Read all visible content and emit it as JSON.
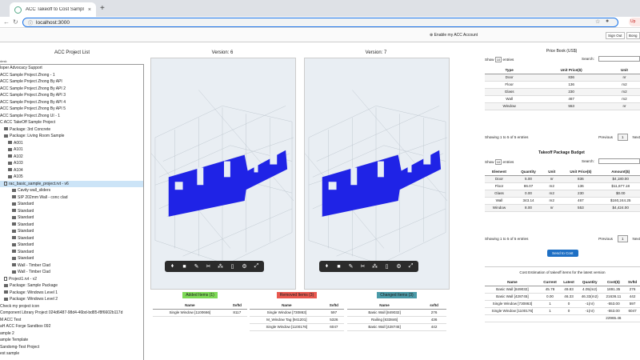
{
  "browser": {
    "tab_title": "ACC Takeoff to Cost Sample",
    "url": "localhost:3000",
    "new_tab_symbol": "+",
    "close_symbol": "×",
    "update_label": "Up"
  },
  "app": {
    "left_stub": "desk",
    "enable_account": "Enable my ACC Account",
    "sign_out": "Sign Out",
    "user_btn": "Bong"
  },
  "project_list": {
    "title": "ACC Project List",
    "items": [
      {
        "label": "loper Advocacy Support",
        "indent": 0,
        "icon": "none"
      },
      {
        "label": "ACC Sample Project Zhong - 1",
        "indent": 0,
        "icon": "none"
      },
      {
        "label": "ACC Sample Project Zhong By API",
        "indent": 0,
        "icon": "none"
      },
      {
        "label": "ACC Sample Project Zhong By API 2",
        "indent": 0,
        "icon": "none"
      },
      {
        "label": "ACC Sample Project Zhong By API 3",
        "indent": 0,
        "icon": "none"
      },
      {
        "label": "ACC Sample Project Zhong By API 4",
        "indent": 0,
        "icon": "none"
      },
      {
        "label": "ACC Sample Project Zhong By API 5",
        "indent": 0,
        "icon": "none"
      },
      {
        "label": "ACC Sample Project Zhong UI - 1",
        "indent": 0,
        "icon": "none"
      },
      {
        "label": "C ACC TakeOff Sample Project",
        "indent": 0,
        "icon": "none"
      },
      {
        "label": "Package: 3rd Concrete",
        "indent": 1,
        "icon": "folder"
      },
      {
        "label": "Package: Living Room Sample",
        "indent": 1,
        "icon": "folder"
      },
      {
        "label": "A001",
        "indent": 2,
        "icon": "folder"
      },
      {
        "label": "A101",
        "indent": 2,
        "icon": "folder"
      },
      {
        "label": "A102",
        "indent": 2,
        "icon": "folder"
      },
      {
        "label": "A103",
        "indent": 2,
        "icon": "folder"
      },
      {
        "label": "A104",
        "indent": 2,
        "icon": "folder"
      },
      {
        "label": "A105",
        "indent": 2,
        "icon": "folder"
      },
      {
        "label": "rac_basic_sample_project.rvt - v6",
        "indent": 1,
        "icon": "doc",
        "selected": true
      },
      {
        "label": "Cavity wall_sliders",
        "indent": 3,
        "icon": "folder"
      },
      {
        "label": "SIP 202mm Wall - conc clad",
        "indent": 3,
        "icon": "folder"
      },
      {
        "label": "Standard",
        "indent": 3,
        "icon": "folder"
      },
      {
        "label": "Standard",
        "indent": 3,
        "icon": "folder"
      },
      {
        "label": "Standard",
        "indent": 3,
        "icon": "folder"
      },
      {
        "label": "Standard",
        "indent": 3,
        "icon": "folder"
      },
      {
        "label": "Standard",
        "indent": 3,
        "icon": "folder"
      },
      {
        "label": "Standard",
        "indent": 3,
        "icon": "folder"
      },
      {
        "label": "Standard",
        "indent": 3,
        "icon": "folder"
      },
      {
        "label": "Standard",
        "indent": 3,
        "icon": "folder"
      },
      {
        "label": "Standard",
        "indent": 3,
        "icon": "folder"
      },
      {
        "label": "Wall - Timber Clad",
        "indent": 3,
        "icon": "folder"
      },
      {
        "label": "Wall - Timber Clad",
        "indent": 3,
        "icon": "folder"
      },
      {
        "label": "Project1.rvt - v2",
        "indent": 1,
        "icon": "doc"
      },
      {
        "label": "Package: Sample Package",
        "indent": 1,
        "icon": "folder"
      },
      {
        "label": "Package: Windows Level 1",
        "indent": 1,
        "icon": "folder"
      },
      {
        "label": "Package: Windows Level 2",
        "indent": 1,
        "icon": "folder"
      },
      {
        "label": "Check my project icon",
        "indent": 0,
        "icon": "none"
      },
      {
        "label": "Component Library Project 024d6487-98d4-46bd-bd85-f8f6602b117d",
        "indent": 0,
        "icon": "none"
      },
      {
        "label": "M ACC Test",
        "indent": 0,
        "icon": "none"
      },
      {
        "label": "aH ACC Forge Sandbox 092",
        "indent": 0,
        "icon": "none"
      },
      {
        "label": "ample 2",
        "indent": 0,
        "icon": "none"
      },
      {
        "label": "ample Template",
        "indent": 0,
        "icon": "none"
      },
      {
        "label": "Sandomg-Test Project",
        "indent": 0,
        "icon": "none"
      },
      {
        "label": "est sample",
        "indent": 0,
        "icon": "none"
      }
    ]
  },
  "viewers": [
    {
      "title": "Version: 6"
    },
    {
      "title": "Version: 7"
    }
  ],
  "toolbar_icons": [
    "walk-icon",
    "camera-icon",
    "measure-icon",
    "section-icon",
    "explode-icon",
    "model-browser-icon",
    "settings-icon",
    "fullscreen-icon"
  ],
  "toolbar_glyphs": [
    "⬧",
    "■",
    "✎",
    "✂",
    "⁂",
    "▯",
    "⚙",
    "⤢"
  ],
  "diff": {
    "added": {
      "label": "Added Items (1)",
      "color": "#7ed957",
      "cols": [
        "Name",
        "SvfId"
      ],
      "rows": [
        [
          "Single Window [1100666]",
          "8117"
        ]
      ]
    },
    "removed": {
      "label": "Removed Items (3)",
      "color": "#e8584f",
      "cols": [
        "Name",
        "SvfId"
      ],
      "rows": [
        [
          "Single Window [730863]",
          "597"
        ],
        [
          "M_Window Tag [941201]",
          "5326"
        ],
        [
          "Single Window [1100176]",
          "6047"
        ]
      ]
    },
    "changed": {
      "label": "Changed Items (3)",
      "color": "#4a9aa8",
      "cols": [
        "Name",
        "svfId"
      ],
      "rows": [
        [
          "Basic Wall [849032]",
          "276"
        ],
        [
          "Railing [833846]",
          "436"
        ],
        [
          "Basic Wall [428745]",
          "442"
        ]
      ]
    }
  },
  "price_book": {
    "title": "Price Book (US$)",
    "show": "Show",
    "entries_val": "10",
    "entries": "entries",
    "search": "Search:",
    "cols": [
      "Type",
      "Unit Price($)",
      "Unit"
    ],
    "rows": [
      [
        "Door",
        "836",
        "nr"
      ],
      [
        "Floor",
        "136",
        "m2"
      ],
      [
        "Glass",
        "230",
        "m2"
      ],
      [
        "Wall",
        "467",
        "m2"
      ],
      [
        "Window",
        "553",
        "nr"
      ]
    ],
    "info": "Showing 1 to 5 of 5 entries",
    "prev": "Previous",
    "page": "1",
    "next": "Next"
  },
  "budget": {
    "title": "Takeoff Package Budget",
    "show": "Show",
    "entries_val": "10",
    "entries": "entries",
    "search": "Search:",
    "cols": [
      "Element",
      "Quantity",
      "Unit",
      "Unit Price($)",
      "Amount($)"
    ],
    "rows": [
      [
        "Door",
        "5.00",
        "nr",
        "836",
        "$4,180.00"
      ],
      [
        "Floor",
        "86.07",
        "m2",
        "136",
        "$11,677.18"
      ],
      [
        "Glass",
        "0.00",
        "m2",
        "230",
        "$0.00"
      ],
      [
        "Wall",
        "343.14",
        "m2",
        "467",
        "$160,244.25"
      ],
      [
        "Window",
        "8.00",
        "nr",
        "553",
        "$4,424.00"
      ]
    ],
    "info": "Showing 1 to 5 of 5 entries",
    "prev": "Previous",
    "page": "1",
    "next": "Next",
    "send": "Send to Cost"
  },
  "estimation": {
    "title": "Cost Estimation of takeoff items for the latest version",
    "cols": [
      "Name",
      "Current",
      "Latest",
      "Quantity",
      "Cost($)",
      "SvfId"
    ],
    "rows": [
      [
        "Basic Wall [849032]",
        "45.78",
        "49.83",
        "4.05(m2)",
        "1891.35",
        "276"
      ],
      [
        "Basic Wall [428745]",
        "0.00",
        "46.33",
        "46.33(m2)",
        "21636.11",
        "442"
      ],
      [
        "Single Window [730863]",
        "1",
        "0",
        "-1(nr)",
        "-553.00",
        "597"
      ],
      [
        "Single Window [1100176]",
        "1",
        "0",
        "-1(nr)",
        "-553.00",
        "6047"
      ],
      [
        "",
        "",
        "",
        "",
        "22965.46",
        ""
      ]
    ]
  }
}
